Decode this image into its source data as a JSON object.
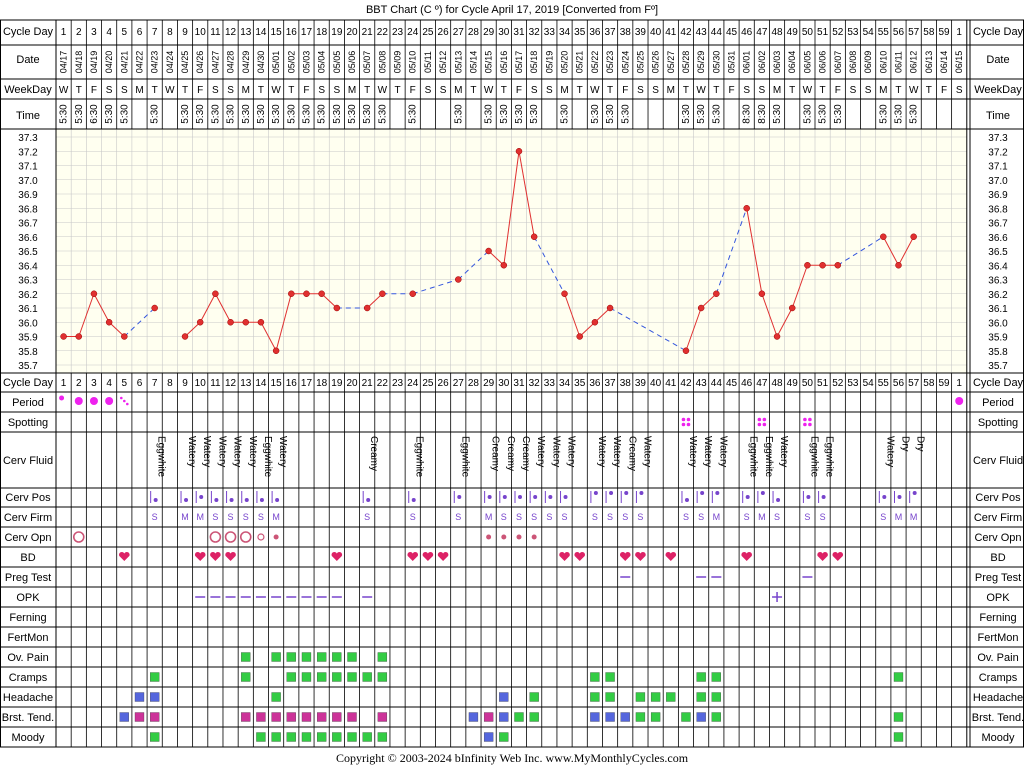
{
  "title": "BBT Chart (C º) for Cycle April 17, 2019  [Converted from Fº]",
  "copyright": "Copyright © 2003-2024 bInfinity Web Inc.    www.MyMonthlyCycles.com",
  "row_labels": {
    "cycle_day": "Cycle Day",
    "date": "Date",
    "weekday": "WeekDay",
    "time": "Time",
    "period": "Period",
    "spotting": "Spotting",
    "cerv_fluid": "Cerv Fluid",
    "cerv_pos": "Cerv Pos",
    "cerv_firm": "Cerv Firm",
    "cerv_opn": "Cerv Opn",
    "bd": "BD",
    "preg_test": "Preg Test",
    "opk": "OPK",
    "ferning": "Ferning",
    "fertmon": "FertMon",
    "ov_pain": "Ov. Pain",
    "cramps": "Cramps",
    "headache": "Headache",
    "brst_tend": "Brst. Tend.",
    "moody": "Moody"
  },
  "colors": {
    "line": "#e03030",
    "projected": "#3355dd",
    "chart_bg": "#fffff0",
    "grid": "#c8c8c8",
    "green": "#33cc44",
    "blue": "#5566dd",
    "magenta": "#cc3399",
    "purple": "#7744cc",
    "heart": "#dd2266",
    "period": "#ee22ee",
    "opn": "#cc5577"
  },
  "chart_data": {
    "type": "line",
    "ylim": [
      35.7,
      37.3
    ],
    "y_ticks": [
      "37.3",
      "37.2",
      "37.1",
      "37.0",
      "36.9",
      "36.8",
      "36.7",
      "36.6",
      "36.5",
      "36.4",
      "36.3",
      "36.2",
      "36.1",
      "36.0",
      "35.9",
      "35.8",
      "35.7"
    ],
    "cycle_days": [
      "1",
      "2",
      "3",
      "4",
      "5",
      "6",
      "7",
      "8",
      "9",
      "10",
      "11",
      "12",
      "13",
      "14",
      "15",
      "16",
      "17",
      "18",
      "19",
      "20",
      "21",
      "22",
      "23",
      "24",
      "25",
      "26",
      "27",
      "28",
      "29",
      "30",
      "31",
      "32",
      "33",
      "34",
      "35",
      "36",
      "37",
      "38",
      "39",
      "40",
      "41",
      "42",
      "43",
      "44",
      "45",
      "46",
      "47",
      "48",
      "49",
      "50",
      "51",
      "52",
      "53",
      "54",
      "55",
      "56",
      "57",
      "58",
      "59",
      "1"
    ],
    "dates": [
      "04/17",
      "04/18",
      "04/19",
      "04/20",
      "04/21",
      "04/22",
      "04/23",
      "04/24",
      "04/25",
      "04/26",
      "04/27",
      "04/28",
      "04/29",
      "04/30",
      "05/01",
      "05/02",
      "05/03",
      "05/04",
      "05/05",
      "05/06",
      "05/07",
      "05/08",
      "05/09",
      "05/10",
      "05/11",
      "05/12",
      "05/13",
      "05/14",
      "05/15",
      "05/16",
      "05/17",
      "05/18",
      "05/19",
      "05/20",
      "05/21",
      "05/22",
      "05/23",
      "05/24",
      "05/25",
      "05/26",
      "05/27",
      "05/28",
      "05/29",
      "05/30",
      "05/31",
      "06/01",
      "06/02",
      "06/03",
      "06/04",
      "06/05",
      "06/06",
      "06/07",
      "06/08",
      "06/09",
      "06/10",
      "06/11",
      "06/12",
      "06/13",
      "06/14",
      "06/15"
    ],
    "weekdays": [
      "W",
      "T",
      "F",
      "S",
      "S",
      "M",
      "T",
      "W",
      "T",
      "F",
      "S",
      "S",
      "M",
      "T",
      "W",
      "T",
      "F",
      "S",
      "S",
      "M",
      "T",
      "W",
      "T",
      "F",
      "S",
      "S",
      "M",
      "T",
      "W",
      "T",
      "F",
      "S",
      "S",
      "M",
      "T",
      "W",
      "T",
      "F",
      "S",
      "S",
      "M",
      "T",
      "W",
      "T",
      "F",
      "S",
      "S",
      "M",
      "T",
      "W",
      "T",
      "F",
      "S",
      "S",
      "M",
      "T",
      "W",
      "T",
      "F",
      "S"
    ],
    "times": [
      "5:30",
      "5:30",
      "6:30",
      "5:30",
      "5:30",
      "",
      "5:30",
      "",
      "5:30",
      "5:30",
      "5:30",
      "5:30",
      "5:30",
      "5:30",
      "5:30",
      "5:30",
      "5:30",
      "5:30",
      "5:30",
      "5:30",
      "5:30",
      "5:30",
      "",
      "5:30",
      "",
      "",
      "5:30",
      "",
      "5:30",
      "5:30",
      "5:30",
      "5:30",
      "",
      "5:30",
      "",
      "5:30",
      "5:30",
      "5:30",
      "",
      "",
      "",
      "5:30",
      "5:30",
      "5:30",
      "",
      "8:30",
      "8:30",
      "5:30",
      "",
      "5:30",
      "5:30",
      "5:30",
      "",
      "",
      "5:30",
      "5:30",
      "5:30",
      "",
      "",
      ""
    ],
    "temps": [
      35.9,
      35.9,
      36.2,
      36.0,
      35.9,
      null,
      36.1,
      null,
      35.9,
      36.0,
      36.2,
      36.0,
      36.0,
      36.0,
      35.8,
      36.2,
      36.2,
      36.2,
      36.1,
      null,
      36.1,
      36.2,
      null,
      36.2,
      null,
      null,
      36.3,
      null,
      36.5,
      36.4,
      37.2,
      36.6,
      null,
      36.2,
      35.9,
      36.0,
      36.1,
      null,
      null,
      null,
      null,
      35.8,
      36.1,
      36.2,
      null,
      36.8,
      36.2,
      35.9,
      36.1,
      36.4,
      36.4,
      36.4,
      null,
      null,
      36.6,
      36.4,
      36.6,
      null,
      null,
      null
    ],
    "interpolated": [
      [
        5,
        7
      ],
      [
        19,
        21
      ],
      [
        22,
        24
      ],
      [
        24,
        27
      ],
      [
        27,
        29
      ],
      [
        32,
        34
      ],
      [
        37,
        42
      ],
      [
        44,
        46
      ],
      [
        52,
        55
      ]
    ]
  },
  "observations": {
    "period": [
      [
        1,
        "dot-small"
      ],
      [
        2,
        "dot"
      ],
      [
        3,
        "dot"
      ],
      [
        4,
        "dot"
      ],
      [
        5,
        "spot"
      ],
      [
        60,
        "dot"
      ]
    ],
    "spotting": [
      42,
      47,
      50
    ],
    "cerv_fluid": [
      [
        7,
        "Eggwhite"
      ],
      [
        9,
        "Watery"
      ],
      [
        10,
        "Watery"
      ],
      [
        11,
        "Watery"
      ],
      [
        12,
        "Watery"
      ],
      [
        13,
        "Watery"
      ],
      [
        14,
        "Eggwhite"
      ],
      [
        15,
        "Watery"
      ],
      [
        21,
        "Creamy"
      ],
      [
        24,
        "Eggwhite"
      ],
      [
        27,
        "Eggwhite"
      ],
      [
        29,
        "Creamy"
      ],
      [
        30,
        "Creamy"
      ],
      [
        31,
        "Creamy"
      ],
      [
        32,
        "Watery"
      ],
      [
        33,
        "Watery"
      ],
      [
        34,
        "Watery"
      ],
      [
        36,
        "Watery"
      ],
      [
        37,
        "Watery"
      ],
      [
        38,
        "Creamy"
      ],
      [
        39,
        "Watery"
      ],
      [
        42,
        "Watery"
      ],
      [
        43,
        "Watery"
      ],
      [
        44,
        "Watery"
      ],
      [
        46,
        "Eggwhite"
      ],
      [
        47,
        "Eggwhite"
      ],
      [
        48,
        "Watery"
      ],
      [
        50,
        "Eggwhite"
      ],
      [
        51,
        "Eggwhite"
      ],
      [
        55,
        "Watery"
      ],
      [
        56,
        "Dry"
      ],
      [
        57,
        "Dry"
      ]
    ],
    "cerv_pos": [
      [
        7,
        "low"
      ],
      [
        9,
        "low"
      ],
      [
        10,
        "mid"
      ],
      [
        11,
        "low"
      ],
      [
        12,
        "low"
      ],
      [
        13,
        "low"
      ],
      [
        14,
        "low"
      ],
      [
        15,
        "low"
      ],
      [
        21,
        "low"
      ],
      [
        24,
        "low"
      ],
      [
        27,
        "mid"
      ],
      [
        29,
        "mid"
      ],
      [
        30,
        "mid"
      ],
      [
        31,
        "mid"
      ],
      [
        32,
        "mid"
      ],
      [
        33,
        "mid"
      ],
      [
        34,
        "mid"
      ],
      [
        36,
        "high"
      ],
      [
        37,
        "high"
      ],
      [
        38,
        "high"
      ],
      [
        39,
        "high"
      ],
      [
        42,
        "low"
      ],
      [
        43,
        "high"
      ],
      [
        44,
        "high"
      ],
      [
        46,
        "mid"
      ],
      [
        47,
        "high"
      ],
      [
        48,
        "low"
      ],
      [
        50,
        "mid"
      ],
      [
        51,
        "mid"
      ],
      [
        55,
        "mid"
      ],
      [
        56,
        "mid"
      ],
      [
        57,
        "high"
      ]
    ],
    "cerv_firm": [
      [
        7,
        "S"
      ],
      [
        9,
        "M"
      ],
      [
        10,
        "M"
      ],
      [
        11,
        "S"
      ],
      [
        12,
        "S"
      ],
      [
        13,
        "S"
      ],
      [
        14,
        "S"
      ],
      [
        15,
        "M"
      ],
      [
        21,
        "S"
      ],
      [
        24,
        "S"
      ],
      [
        27,
        "S"
      ],
      [
        29,
        "M"
      ],
      [
        30,
        "S"
      ],
      [
        31,
        "S"
      ],
      [
        32,
        "S"
      ],
      [
        33,
        "S"
      ],
      [
        34,
        "S"
      ],
      [
        36,
        "S"
      ],
      [
        37,
        "S"
      ],
      [
        38,
        "S"
      ],
      [
        39,
        "S"
      ],
      [
        42,
        "S"
      ],
      [
        43,
        "S"
      ],
      [
        44,
        "M"
      ],
      [
        46,
        "S"
      ],
      [
        47,
        "M"
      ],
      [
        48,
        "S"
      ],
      [
        50,
        "S"
      ],
      [
        51,
        "S"
      ],
      [
        55,
        "S"
      ],
      [
        56,
        "M"
      ],
      [
        57,
        "M"
      ]
    ],
    "cerv_opn": [
      [
        2,
        "open"
      ],
      [
        11,
        "open"
      ],
      [
        12,
        "open"
      ],
      [
        13,
        "open"
      ],
      [
        14,
        "med"
      ],
      [
        15,
        "closed"
      ],
      [
        29,
        "closed"
      ],
      [
        30,
        "closed"
      ],
      [
        31,
        "closed"
      ],
      [
        32,
        "closed"
      ]
    ],
    "bd": [
      5,
      10,
      11,
      12,
      19,
      24,
      25,
      26,
      34,
      35,
      38,
      39,
      41,
      46,
      51,
      52
    ],
    "preg_test": [
      38,
      43,
      44,
      50
    ],
    "opk": [
      [
        10,
        "neg"
      ],
      [
        11,
        "neg"
      ],
      [
        12,
        "neg"
      ],
      [
        13,
        "neg"
      ],
      [
        14,
        "neg"
      ],
      [
        15,
        "neg"
      ],
      [
        16,
        "neg"
      ],
      [
        17,
        "neg"
      ],
      [
        18,
        "neg"
      ],
      [
        19,
        "neg"
      ],
      [
        21,
        "neg"
      ],
      [
        48,
        "pos"
      ]
    ],
    "ferning": [],
    "fertmon": [],
    "ov_pain": [
      [
        13,
        "green"
      ],
      [
        15,
        "green"
      ],
      [
        16,
        "green"
      ],
      [
        17,
        "green"
      ],
      [
        18,
        "green"
      ],
      [
        19,
        "green"
      ],
      [
        20,
        "green"
      ],
      [
        22,
        "green"
      ]
    ],
    "cramps": [
      [
        7,
        "green"
      ],
      [
        13,
        "green"
      ],
      [
        16,
        "green"
      ],
      [
        17,
        "green"
      ],
      [
        18,
        "green"
      ],
      [
        19,
        "green"
      ],
      [
        20,
        "green"
      ],
      [
        21,
        "green"
      ],
      [
        22,
        "green"
      ],
      [
        36,
        "green"
      ],
      [
        37,
        "green"
      ],
      [
        43,
        "green"
      ],
      [
        44,
        "green"
      ],
      [
        56,
        "green"
      ]
    ],
    "headache": [
      [
        6,
        "blue"
      ],
      [
        7,
        "blue"
      ],
      [
        15,
        "green"
      ],
      [
        30,
        "blue"
      ],
      [
        32,
        "green"
      ],
      [
        36,
        "green"
      ],
      [
        37,
        "green"
      ],
      [
        39,
        "green"
      ],
      [
        40,
        "green"
      ],
      [
        41,
        "green"
      ],
      [
        43,
        "green"
      ],
      [
        44,
        "green"
      ]
    ],
    "brst_tend": [
      [
        5,
        "blue"
      ],
      [
        6,
        "magenta"
      ],
      [
        7,
        "magenta"
      ],
      [
        13,
        "magenta"
      ],
      [
        14,
        "magenta"
      ],
      [
        15,
        "magenta"
      ],
      [
        16,
        "magenta"
      ],
      [
        17,
        "magenta"
      ],
      [
        18,
        "magenta"
      ],
      [
        19,
        "magenta"
      ],
      [
        20,
        "magenta"
      ],
      [
        22,
        "magenta"
      ],
      [
        28,
        "blue"
      ],
      [
        29,
        "magenta"
      ],
      [
        30,
        "blue"
      ],
      [
        31,
        "green"
      ],
      [
        32,
        "green"
      ],
      [
        36,
        "blue"
      ],
      [
        37,
        "blue"
      ],
      [
        38,
        "blue"
      ],
      [
        39,
        "green"
      ],
      [
        40,
        "green"
      ],
      [
        42,
        "green"
      ],
      [
        43,
        "blue"
      ],
      [
        44,
        "green"
      ],
      [
        56,
        "green"
      ]
    ],
    "moody": [
      [
        7,
        "green"
      ],
      [
        14,
        "green"
      ],
      [
        15,
        "green"
      ],
      [
        16,
        "green"
      ],
      [
        17,
        "green"
      ],
      [
        18,
        "green"
      ],
      [
        19,
        "green"
      ],
      [
        20,
        "green"
      ],
      [
        21,
        "green"
      ],
      [
        22,
        "green"
      ],
      [
        29,
        "blue"
      ],
      [
        30,
        "green"
      ],
      [
        56,
        "green"
      ]
    ]
  }
}
